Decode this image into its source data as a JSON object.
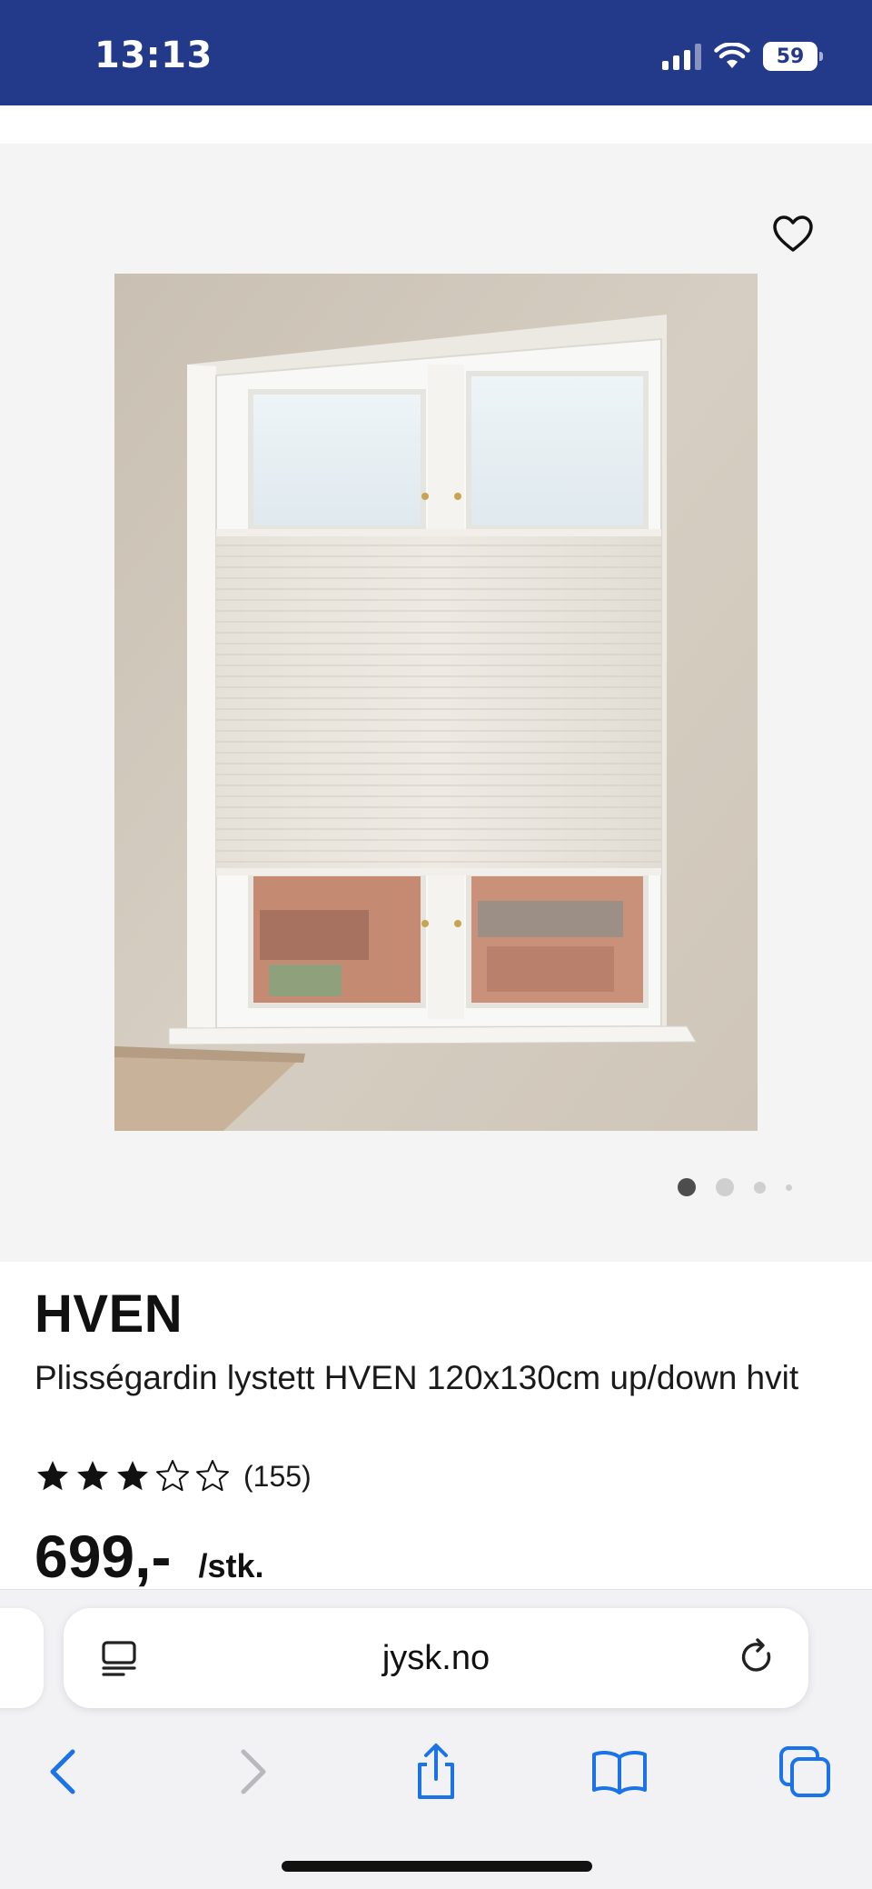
{
  "status_bar": {
    "time": "13:13",
    "battery": "59",
    "signal_icon": "cellular-signal-icon",
    "wifi_icon": "wifi-icon",
    "background_color": "#233a8b"
  },
  "gallery": {
    "favorite_icon": "heart-outline-icon",
    "image_alt": "Plisségardin hvit i vindu",
    "dots_total": 4,
    "dots_active_index": 0
  },
  "product": {
    "brand": "HVEN",
    "name": "Plisségardin lystett HVEN 120x130cm up/down hvit",
    "rating_filled": 3,
    "rating_max": 5,
    "review_count": "(155)",
    "price": "699,-",
    "unit": "/stk."
  },
  "browser": {
    "url": "jysk.no",
    "reader_icon": "page-menu-icon",
    "reload_icon": "reload-icon",
    "toolbar": [
      "back-icon",
      "forward-icon",
      "share-icon",
      "bookmarks-icon",
      "tabs-icon"
    ],
    "accent_color": "#1a73e8"
  }
}
